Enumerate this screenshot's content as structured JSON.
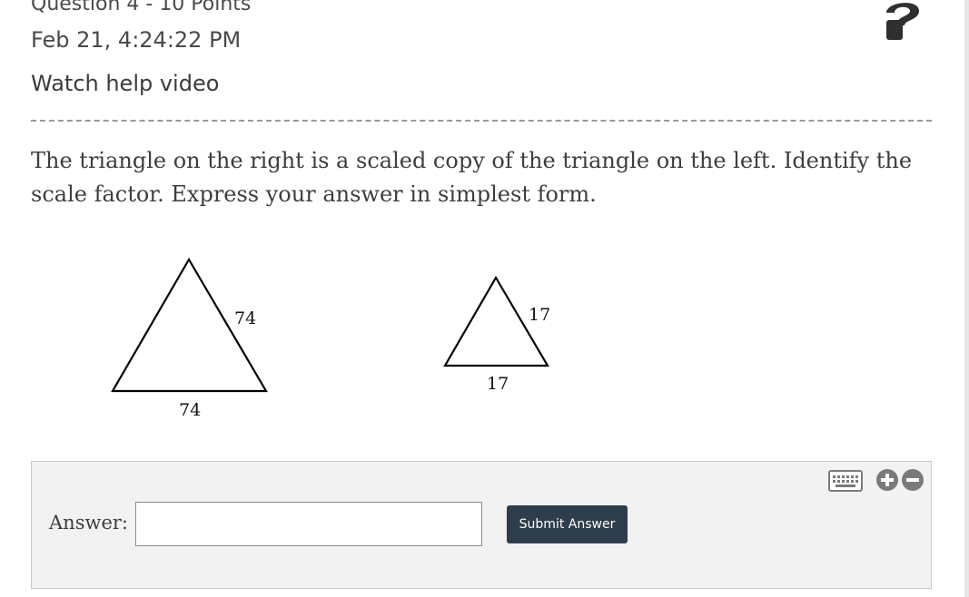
{
  "header": {
    "question_title": "Question 4 - 10 Points",
    "timestamp": "Feb 21, 4:24:22 PM",
    "help_link": "Watch help video",
    "help_icon": "question-mark-icon"
  },
  "question": {
    "prompt": "The triangle on the right is a scaled copy of the triangle on the left. Identify the scale factor. Express your answer in simplest form."
  },
  "figure": {
    "left_triangle": {
      "side_label": "74",
      "base_label": "74"
    },
    "right_triangle": {
      "side_label": "17",
      "base_label": "17"
    }
  },
  "answer": {
    "label": "Answer:",
    "input_value": "",
    "input_placeholder": "",
    "submit_label": "Submit Answer",
    "tools": [
      "keyboard-icon",
      "zoom-in-icon",
      "zoom-out-icon"
    ]
  },
  "colors": {
    "button_bg": "#2e3d4c",
    "panel_bg": "#f2f2f2",
    "icon_gray": "#7a7a7a",
    "help_icon": "#2f2f2f"
  }
}
